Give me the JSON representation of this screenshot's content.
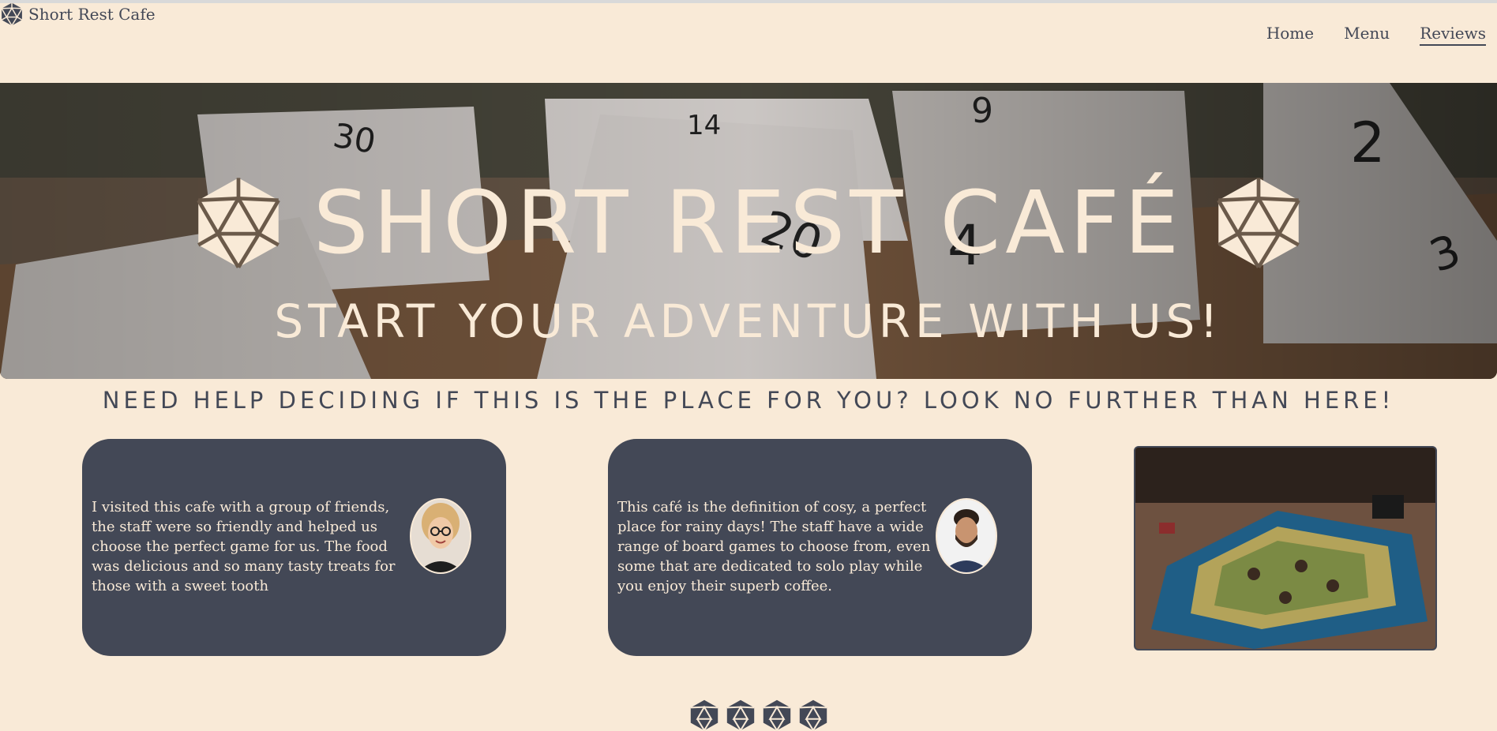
{
  "header": {
    "brand_name": "Short Rest Cafe",
    "logo_icon": "d20-dice-icon",
    "nav": [
      {
        "label": "Home",
        "active": false
      },
      {
        "label": "Menu",
        "active": false
      },
      {
        "label": "Reviews",
        "active": true
      }
    ]
  },
  "hero": {
    "title": "SHORT REST CAFÉ",
    "subtitle": "START YOUR ADVENTURE WITH US!",
    "background_image": "polyhedral-dice-photo",
    "title_icon": "d20-dice-icon"
  },
  "tagline": "NEED HELP DECIDING IF THIS IS THE PLACE FOR YOU? LOOK NO FURTHER THAN HERE!",
  "reviews": [
    {
      "text": "I visited this cafe with a group of friends, the staff were so friendly and helped us choose the perfect game for us. The food was delicious and so many tasty treats for those with a sweet tooth",
      "avatar": "woman-with-glasses-avatar"
    },
    {
      "text": "This café is the definition of cosy, a perfect place for rainy days! The staff have a wide range of board games to choose from, even some that are dedicated to solo play while you enjoy their superb coffee.",
      "avatar": "bearded-man-avatar"
    }
  ],
  "side_image": "board-game-catan-photo",
  "rating_icons": [
    "d20-dice-icon",
    "d20-dice-icon",
    "d20-dice-icon",
    "d20-dice-icon"
  ],
  "colors": {
    "background": "#f9ead7",
    "dark": "#434856",
    "cream": "#f9ead7"
  }
}
